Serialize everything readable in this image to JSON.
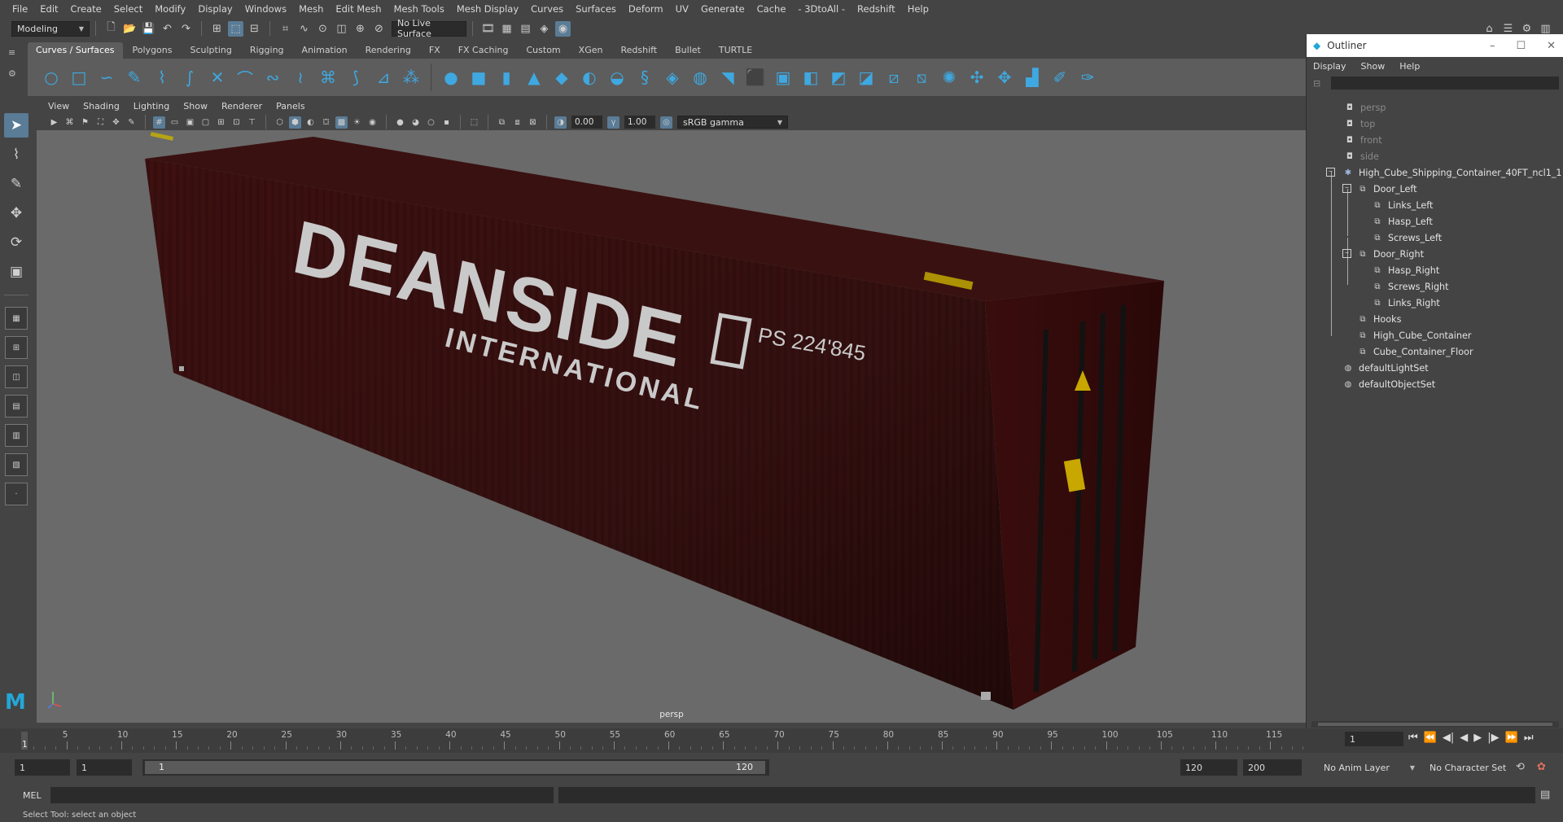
{
  "menubar": [
    "File",
    "Edit",
    "Create",
    "Select",
    "Modify",
    "Display",
    "Windows",
    "Mesh",
    "Edit Mesh",
    "Mesh Tools",
    "Mesh Display",
    "Curves",
    "Surfaces",
    "Deform",
    "UV",
    "Generate",
    "Cache",
    "- 3DtoAll -",
    "Redshift",
    "Help"
  ],
  "status": {
    "mode": "Modeling",
    "live_surface": "No Live Surface"
  },
  "shelf_tabs": [
    "Curves / Surfaces",
    "Polygons",
    "Sculpting",
    "Rigging",
    "Animation",
    "Rendering",
    "FX",
    "FX Caching",
    "Custom",
    "XGen",
    "Redshift",
    "Bullet",
    "TURTLE"
  ],
  "viewport": {
    "menu": [
      "View",
      "Shading",
      "Lighting",
      "Show",
      "Renderer",
      "Panels"
    ],
    "exposure": "0.00",
    "gamma": "1.00",
    "color_space": "sRGB gamma",
    "camera_label": "persp"
  },
  "container_text": {
    "brand": "DEANSIDE",
    "sub": "INTERNATIONAL",
    "code": "PS 224'845"
  },
  "outliner": {
    "title": "Outliner",
    "menu": [
      "Display",
      "Show",
      "Help"
    ],
    "cameras": [
      "persp",
      "top",
      "front",
      "side"
    ],
    "root": "High_Cube_Shipping_Container_40FT_ncl1_1",
    "door_left": "Door_Left",
    "door_left_children": [
      "Links_Left",
      "Hasp_Left",
      "Screws_Left"
    ],
    "door_right": "Door_Right",
    "door_right_children": [
      "Hasp_Right",
      "Screws_Right",
      "Links_Right"
    ],
    "others": [
      "Hooks",
      "High_Cube_Container",
      "Cube_Container_Floor"
    ],
    "sets": [
      "defaultLightSet",
      "defaultObjectSet"
    ]
  },
  "timeline": {
    "ticks": [
      "5",
      "10",
      "15",
      "20",
      "25",
      "30",
      "35",
      "40",
      "45",
      "50",
      "55",
      "60",
      "65",
      "70",
      "75",
      "80",
      "85",
      "90",
      "95",
      "100",
      "105",
      "110",
      "115"
    ],
    "current_frame": "1",
    "frame_field": "1"
  },
  "range": {
    "start": "1",
    "start_inner": "1",
    "slider_start": "1",
    "slider_end": "120",
    "end": "120",
    "anim_end": "200",
    "anim_layer": "No Anim Layer",
    "character_set": "No Character Set"
  },
  "mel_label": "MEL",
  "helpline": "Select Tool: select an object"
}
